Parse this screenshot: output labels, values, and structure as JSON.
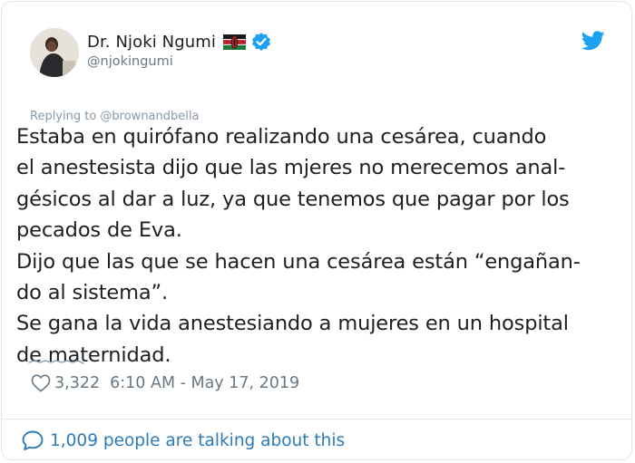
{
  "colors": {
    "text": "#1c2022",
    "muted": "#697882",
    "link": "#2b7bb9",
    "twitter_blue": "#1da1f2",
    "border": "#e1e8ed"
  },
  "author": {
    "display_name": "Dr. Njoki Ngumi",
    "handle": "@njokingumi",
    "flag_icon": "kenya-flag-icon",
    "verified_icon": "verified-badge-icon",
    "avatar_icon": "avatar"
  },
  "header": {
    "bird_icon": "twitter-bird-icon"
  },
  "reply": {
    "label": "Replying to @brownandbella"
  },
  "tweet": {
    "text": "Estaba en quirófano realizando una cesárea, cuando\nel anestesista dijo que las mjeres no merecemos anal-\ngésicos al dar a luz, ya que tenemos que pagar por los\npecados de Eva.\nDijo que las que se hacen una cesárea están “engañan-\ndo al sistema”.\nSe gana la vida anestesiando a mujeres en un hospital\nde maternidad."
  },
  "meta": {
    "heart_icon": "heart-icon",
    "like_count": "3,322",
    "timestamp": "6:10 AM - May 17, 2019"
  },
  "footer": {
    "bubble_icon": "speech-bubble-icon",
    "talking_label": "1,009 people are talking about this"
  }
}
